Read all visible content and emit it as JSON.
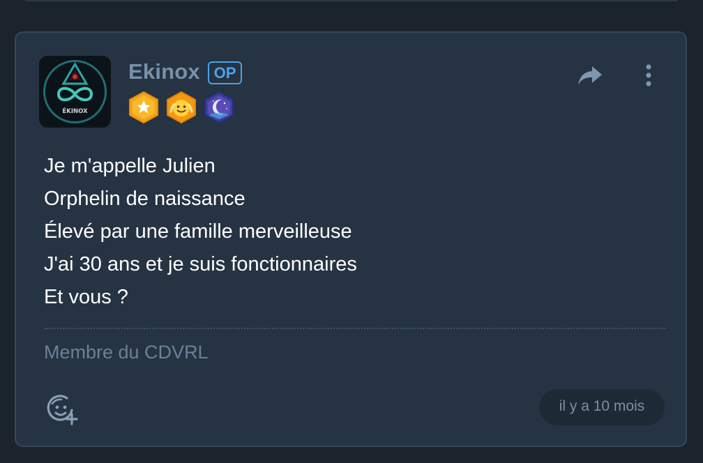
{
  "post": {
    "author": {
      "name": "Ekinox",
      "op_label": "OP",
      "avatar_text": "ÉKINOX",
      "badges": [
        "star-badge-icon",
        "emoji-badge-icon",
        "moon-badge-icon"
      ]
    },
    "actions": {
      "share_icon": "share-icon",
      "menu_icon": "more-vertical-icon"
    },
    "body_lines": [
      "Je m'appelle Julien",
      "Orphelin de naissance",
      "Élevé par une famille merveilleuse",
      "J'ai 30 ans et je suis fonctionnaires",
      "Et vous ?"
    ],
    "signature": "Membre du CDVRL",
    "footer": {
      "reaction_icon": "add-reaction-icon",
      "timestamp": "il y a 10 mois"
    }
  },
  "colors": {
    "background": "#1b242d",
    "card": "#253343",
    "card_border": "#34485b",
    "username": "#7891a9",
    "op_accent": "#4aa3ea",
    "text": "#ffffff",
    "muted": "#6c8196"
  }
}
